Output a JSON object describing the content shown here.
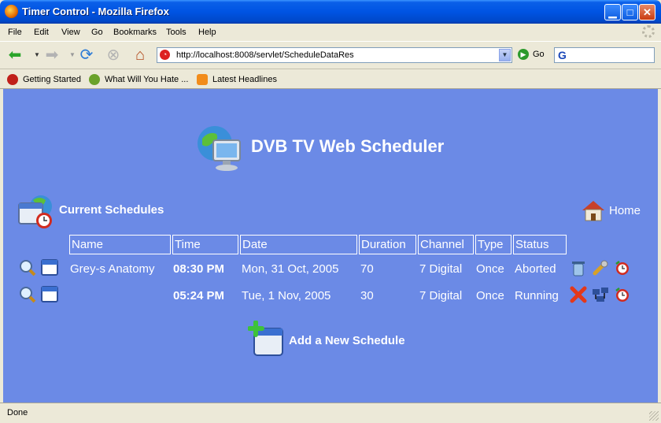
{
  "window": {
    "title": "Timer Control - Mozilla Firefox",
    "minimize": "▁",
    "maximize": "□",
    "close": "✕"
  },
  "menu": [
    "File",
    "Edit",
    "View",
    "Go",
    "Bookmarks",
    "Tools",
    "Help"
  ],
  "nav": {
    "url": "http://localhost:8008/servlet/ScheduleDataRes",
    "go_label": "Go"
  },
  "bookmarks": [
    "Getting Started",
    "What Will You Hate ...",
    "Latest Headlines"
  ],
  "page": {
    "heading": "DVB TV Web Scheduler",
    "section_title": "Current Schedules",
    "home_link": "Home",
    "add_link": "Add a New Schedule",
    "columns": [
      "Name",
      "Time",
      "Date",
      "Duration",
      "Channel",
      "Type",
      "Status"
    ],
    "rows": [
      {
        "name": "Grey-s Anatomy",
        "time": "08:30 PM",
        "date": "Mon, 31 Oct, 2005",
        "duration": "70",
        "channel": "7 Digital",
        "type": "Once",
        "status": "Aborted"
      },
      {
        "name": "",
        "time": "05:24 PM",
        "date": "Tue, 1 Nov, 2005",
        "duration": "30",
        "channel": "7 Digital",
        "type": "Once",
        "status": "Running"
      }
    ]
  },
  "status_bar": {
    "text": "Done"
  },
  "colors": {
    "page_background": "#6b8ae6",
    "titlebar": "#0054e3",
    "chrome": "#ece9d8"
  }
}
